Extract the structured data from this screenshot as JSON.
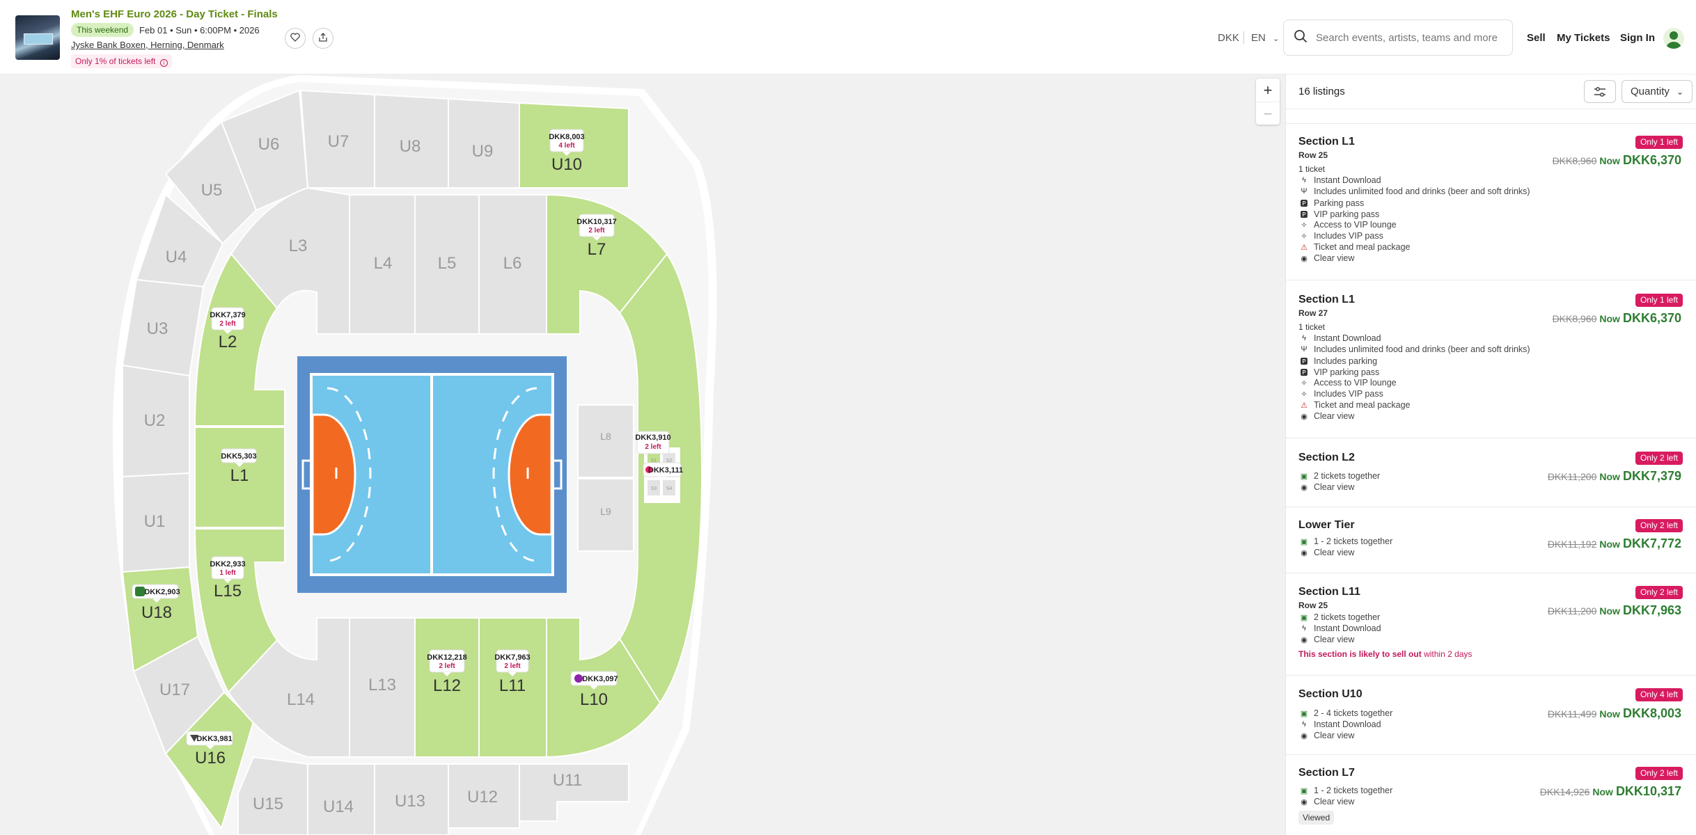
{
  "event": {
    "title": "Men's EHF Euro 2026 - Day Ticket - Finals",
    "badge": "This weekend",
    "date": "Feb 01 • Sun • 6:00PM • 2026",
    "venue": "Jyske Bank Boxen, Herning, Denmark",
    "scarcity": "Only 1% of tickets left"
  },
  "header": {
    "currency": "DKK",
    "language": "EN",
    "search_placeholder": "Search events, artists, teams and more",
    "nav": {
      "sell": "Sell",
      "my_tickets": "My Tickets",
      "sign_in": "Sign In"
    }
  },
  "map": {
    "zoom_in": "+",
    "zoom_out": "−",
    "sections": [
      {
        "id": "U6",
        "label": "U6",
        "available": false
      },
      {
        "id": "U7",
        "label": "U7",
        "available": false
      },
      {
        "id": "U8",
        "label": "U8",
        "available": false
      },
      {
        "id": "U9",
        "label": "U9",
        "available": false
      },
      {
        "id": "U10",
        "label": "U10",
        "available": true
      },
      {
        "id": "U5",
        "label": "U5",
        "available": false
      },
      {
        "id": "U4",
        "label": "U4",
        "available": false
      },
      {
        "id": "U3",
        "label": "U3",
        "available": false
      },
      {
        "id": "U2",
        "label": "U2",
        "available": false
      },
      {
        "id": "U1",
        "label": "U1",
        "available": false
      },
      {
        "id": "U18",
        "label": "U18",
        "available": true
      },
      {
        "id": "U17",
        "label": "U17",
        "available": false
      },
      {
        "id": "U16",
        "label": "U16",
        "available": true
      },
      {
        "id": "U15",
        "label": "U15",
        "available": false
      },
      {
        "id": "U14",
        "label": "U14",
        "available": false
      },
      {
        "id": "U13",
        "label": "U13",
        "available": false
      },
      {
        "id": "U12",
        "label": "U12",
        "available": false
      },
      {
        "id": "U11",
        "label": "U11",
        "available": false
      },
      {
        "id": "L3",
        "label": "L3",
        "available": false
      },
      {
        "id": "L4",
        "label": "L4",
        "available": false
      },
      {
        "id": "L5",
        "label": "L5",
        "available": false
      },
      {
        "id": "L6",
        "label": "L6",
        "available": false
      },
      {
        "id": "L7",
        "label": "L7",
        "available": true
      },
      {
        "id": "L2",
        "label": "L2",
        "available": true
      },
      {
        "id": "L1",
        "label": "L1",
        "available": true
      },
      {
        "id": "L15",
        "label": "L15",
        "available": true
      },
      {
        "id": "L14",
        "label": "L14",
        "available": false
      },
      {
        "id": "L13",
        "label": "L13",
        "available": false
      },
      {
        "id": "L12",
        "label": "L12",
        "available": true
      },
      {
        "id": "L11",
        "label": "L11",
        "available": true
      },
      {
        "id": "L10",
        "label": "L10",
        "available": true
      },
      {
        "id": "L8",
        "label": "L8",
        "available": false
      },
      {
        "id": "L9",
        "label": "L9",
        "available": false
      },
      {
        "id": "R",
        "label": "",
        "available": true
      }
    ],
    "mini_box_labels": [
      "S1",
      "S2",
      "S3",
      "S4"
    ],
    "price_pins": [
      {
        "id": "U10",
        "price": "DKK8,003",
        "left": "4 left",
        "icon": ""
      },
      {
        "id": "L7",
        "price": "DKK10,317",
        "left": "2 left",
        "icon": ""
      },
      {
        "id": "L2",
        "price": "DKK7,379",
        "left": "2 left",
        "icon": ""
      },
      {
        "id": "L1",
        "price": "DKK5,303",
        "left": "",
        "icon": ""
      },
      {
        "id": "L15",
        "price": "DKK2,933",
        "left": "1 left",
        "icon": ""
      },
      {
        "id": "U18",
        "price": "DKK2,903",
        "left": "",
        "icon": "shield-icon"
      },
      {
        "id": "U16",
        "price": "DKK3,981",
        "left": "",
        "icon": "diamond-icon"
      },
      {
        "id": "L12",
        "price": "DKK12,218",
        "left": "2 left",
        "icon": ""
      },
      {
        "id": "L11",
        "price": "DKK7,963",
        "left": "2 left",
        "icon": ""
      },
      {
        "id": "L10",
        "price": "DKK3,097",
        "left": "",
        "icon": "tag-icon"
      },
      {
        "id": "R1",
        "price": "DKK3,910",
        "left": "2 left",
        "icon": ""
      },
      {
        "id": "R2",
        "price": "DKK3,111",
        "left": "",
        "icon": "flame-icon"
      }
    ]
  },
  "panel": {
    "listings_count": "16 listings",
    "quantity_label": "Quantity",
    "listings": [
      {
        "title": "Section L1",
        "row": "Row 25",
        "qty": "1 ticket",
        "badge": "Only 1 left",
        "old_price": "DKK8,960",
        "now_label": "Now",
        "price": "DKK6,370",
        "features": [
          {
            "icon": "lightning-icon",
            "text": "Instant Download"
          },
          {
            "icon": "fork-knife-icon",
            "text": "Includes unlimited food and drinks (beer and soft drinks)"
          },
          {
            "icon": "parking-icon",
            "text": "Parking pass"
          },
          {
            "icon": "parking-icon",
            "text": "VIP parking pass"
          },
          {
            "icon": "sparkle-icon",
            "text": "Access to VIP lounge"
          },
          {
            "icon": "sparkle-icon",
            "text": "Includes VIP pass"
          },
          {
            "icon": "warning-icon",
            "text": "Ticket and meal package"
          },
          {
            "icon": "eye-icon",
            "text": "Clear view"
          }
        ]
      },
      {
        "title": "Section L1",
        "row": "Row 27",
        "qty": "1 ticket",
        "badge": "Only 1 left",
        "old_price": "DKK8,960",
        "now_label": "Now",
        "price": "DKK6,370",
        "features": [
          {
            "icon": "lightning-icon",
            "text": "Instant Download"
          },
          {
            "icon": "fork-knife-icon",
            "text": "Includes unlimited food and drinks (beer and soft drinks)"
          },
          {
            "icon": "parking-icon",
            "text": "Includes parking"
          },
          {
            "icon": "parking-icon",
            "text": "VIP parking pass"
          },
          {
            "icon": "sparkle-icon",
            "text": "Access to VIP lounge"
          },
          {
            "icon": "sparkle-icon",
            "text": "Includes VIP pass"
          },
          {
            "icon": "warning-icon",
            "text": "Ticket and meal package"
          },
          {
            "icon": "eye-icon",
            "text": "Clear view"
          }
        ]
      },
      {
        "title": "Section L2",
        "row": "",
        "qty": "",
        "badge": "Only 2 left",
        "old_price": "DKK11,200",
        "now_label": "Now",
        "price": "DKK7,379",
        "features": [
          {
            "icon": "seats-icon",
            "text": "2 tickets together"
          },
          {
            "icon": "eye-icon",
            "text": "Clear view"
          }
        ]
      },
      {
        "title": "Lower Tier",
        "row": "",
        "qty": "",
        "badge": "Only 2 left",
        "old_price": "DKK11,192",
        "now_label": "Now",
        "price": "DKK7,772",
        "features": [
          {
            "icon": "seats-icon",
            "text": "1 - 2 tickets together"
          },
          {
            "icon": "eye-icon",
            "text": "Clear view"
          }
        ]
      },
      {
        "title": "Section L11",
        "row": "Row 25",
        "qty": "",
        "badge": "Only 2 left",
        "old_price": "DKK11,200",
        "now_label": "Now",
        "price": "DKK7,963",
        "features": [
          {
            "icon": "seats-icon",
            "text": "2 tickets together"
          },
          {
            "icon": "lightning-icon",
            "text": "Instant Download"
          },
          {
            "icon": "eye-icon",
            "text": "Clear view"
          }
        ],
        "sellout": "This section is likely to sell out",
        "sellout_suffix": "within 2 days"
      },
      {
        "title": "Section U10",
        "row": "",
        "qty": "",
        "badge": "Only 4 left",
        "old_price": "DKK11,499",
        "now_label": "Now",
        "price": "DKK8,003",
        "features": [
          {
            "icon": "seats-icon",
            "text": "2 - 4 tickets together"
          },
          {
            "icon": "lightning-icon",
            "text": "Instant Download"
          },
          {
            "icon": "eye-icon",
            "text": "Clear view"
          }
        ]
      },
      {
        "title": "Section L7",
        "row": "",
        "qty": "",
        "badge": "Only 2 left",
        "old_price": "DKK14,926",
        "now_label": "Now",
        "price": "DKK10,317",
        "features": [
          {
            "icon": "seats-icon",
            "text": "1 - 2 tickets together"
          },
          {
            "icon": "eye-icon",
            "text": "Clear view"
          }
        ],
        "viewed": "Viewed"
      }
    ]
  },
  "colors": {
    "available": "#bfe08c",
    "unavailable": "#e3e3e3",
    "court_outer": "#5a8fcb",
    "court_inner": "#72c6ec",
    "goal_area": "#f26a21",
    "price_green": "#2e7d32",
    "badge_pink": "#d81b60",
    "title_green": "#5f8a12"
  }
}
